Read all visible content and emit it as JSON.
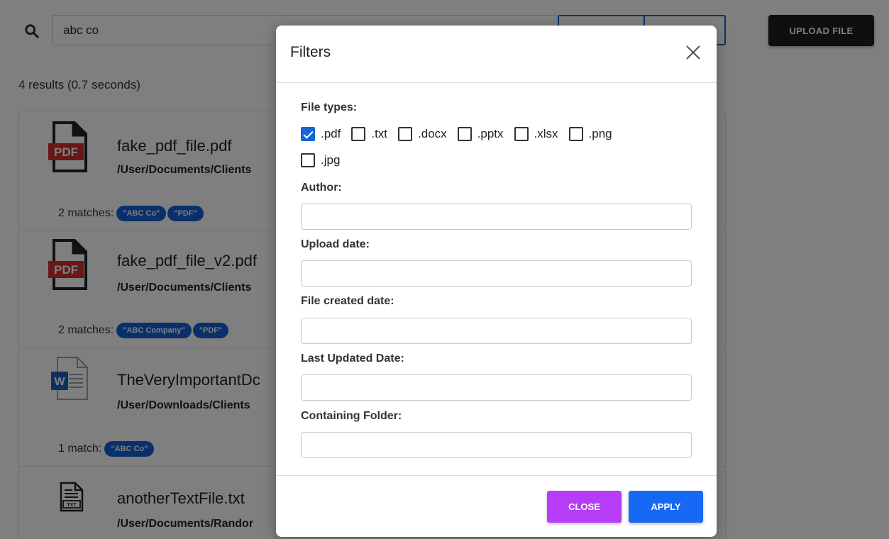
{
  "search": {
    "query": "abc co",
    "upload_label": "UPLOAD FILE"
  },
  "results": {
    "summary": "4 results (0.7 seconds)",
    "items": [
      {
        "icon": "pdf-file-icon",
        "name": "fake_pdf_file.pdf",
        "path": "/User/Documents/Clients",
        "match_label": "2 matches:",
        "chips": [
          "\"ABC Co\"",
          "\"PDF\""
        ]
      },
      {
        "icon": "pdf-file-icon",
        "name": "fake_pdf_file_v2.pdf",
        "path": "/User/Documents/Clients",
        "match_label": "2 matches:",
        "chips": [
          "\"ABC Company\"",
          "\"PDF\""
        ]
      },
      {
        "icon": "word-file-icon",
        "name": "TheVeryImportantDc",
        "path": "/User/Downloads/Clients",
        "match_label": "1 match:",
        "chips": [
          "\"ABC Co\""
        ]
      },
      {
        "icon": "text-file-icon",
        "name": "anotherTextFile.txt",
        "path": "/User/Documents/Randor",
        "match_label": "",
        "chips": []
      }
    ]
  },
  "modal": {
    "title": "Filters",
    "file_types_label": "File types:",
    "file_types": [
      {
        "label": ".pdf",
        "checked": true
      },
      {
        "label": ".txt",
        "checked": false
      },
      {
        "label": ".docx",
        "checked": false
      },
      {
        "label": ".pptx",
        "checked": false
      },
      {
        "label": ".xlsx",
        "checked": false
      },
      {
        "label": ".png",
        "checked": false
      },
      {
        "label": ".jpg",
        "checked": false
      }
    ],
    "fields": {
      "author": {
        "label": "Author:",
        "value": ""
      },
      "upload_date": {
        "label": "Upload date:",
        "value": ""
      },
      "file_created_date": {
        "label": "File created date:",
        "value": ""
      },
      "last_updated_date": {
        "label": "Last Updated Date:",
        "value": ""
      },
      "containing_folder": {
        "label": "Containing Folder:",
        "value": ""
      }
    },
    "close_label": "CLOSE",
    "apply_label": "APPLY"
  },
  "colors": {
    "accent_blue": "#1669f2",
    "close_purple": "#b63cf7",
    "chip_blue": "#1360d6",
    "upload_dark": "#1e1e1e"
  }
}
